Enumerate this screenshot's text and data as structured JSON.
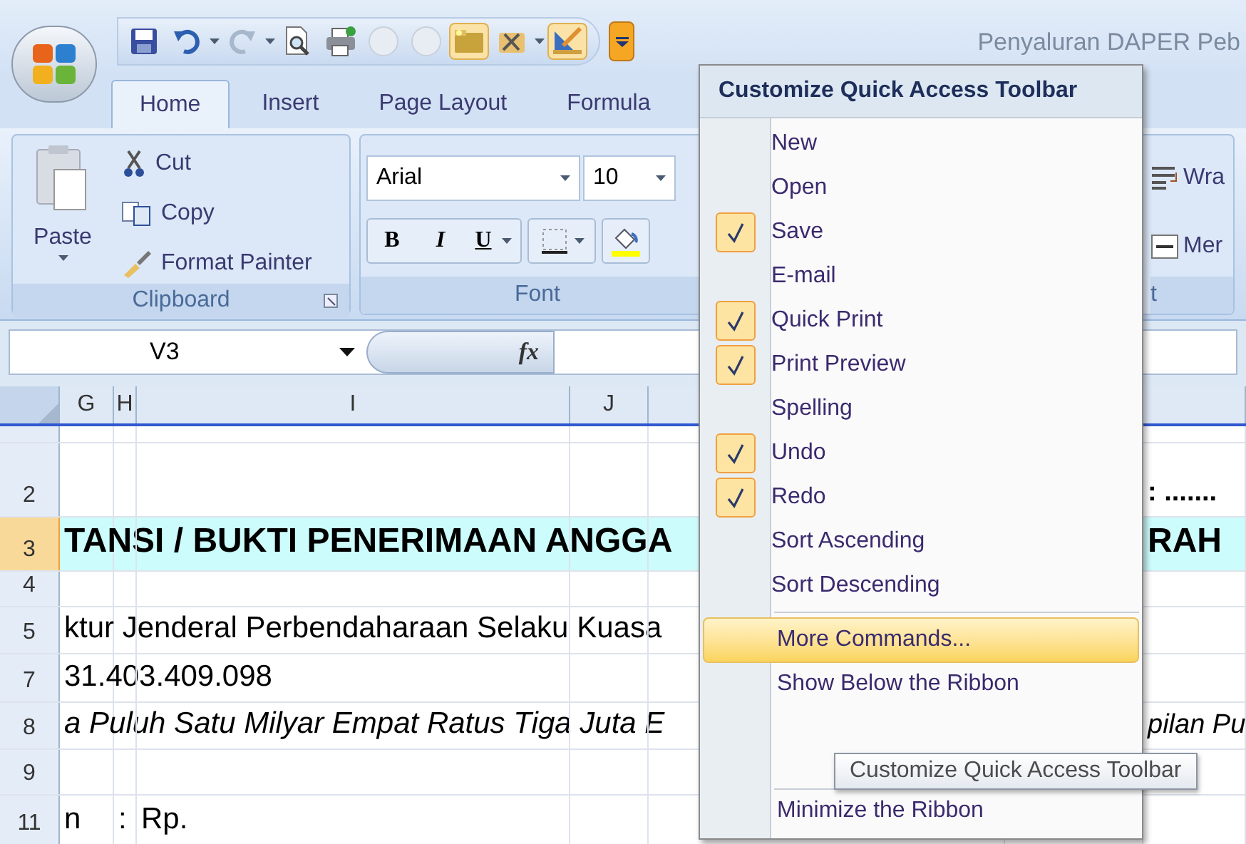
{
  "title_bar": {
    "title": "Penyaluran DAPER Peb"
  },
  "tabs": [
    {
      "label": "Home",
      "selected": true
    },
    {
      "label": "Insert",
      "selected": false
    },
    {
      "label": "Page Layout",
      "selected": false
    },
    {
      "label": "Formula",
      "selected": false
    }
  ],
  "ribbon": {
    "clipboard": {
      "label": "Clipboard",
      "paste": "Paste",
      "cut": "Cut",
      "copy": "Copy",
      "format_painter": "Format Painter"
    },
    "font": {
      "label": "Font",
      "font_name": "Arial",
      "font_size": "10",
      "bold": "B",
      "italic": "I",
      "underline": "U"
    },
    "alignment": {
      "label": "t",
      "wrap": "Wra",
      "merge": "Mer"
    }
  },
  "formula_bar": {
    "name_box": "V3",
    "function_label": "fx"
  },
  "sheet": {
    "columns": [
      "G",
      "H",
      "I",
      "J"
    ],
    "rows": [
      {
        "number": "2",
        "selected": false,
        "highlight": false,
        "kind": "bold",
        "right_text": ": ......."
      },
      {
        "number": "3",
        "selected": true,
        "highlight": true,
        "kind": "title",
        "text": "TANSI / BUKTI PENERIMAAN ANGGA",
        "right_text": "RAH"
      },
      {
        "number": "4",
        "selected": false,
        "highlight": false
      },
      {
        "number": "5",
        "selected": false,
        "highlight": false,
        "kind": "plain",
        "text": "ktur Jenderal Perbendaharaan Selaku Kuasa"
      },
      {
        "number": "7",
        "selected": false,
        "highlight": false,
        "kind": "plain",
        "text": "31.403.409.098"
      },
      {
        "number": "8",
        "selected": false,
        "highlight": false,
        "kind": "italic",
        "text": "a Puluh Satu Milyar Empat Ratus Tiga Juta E",
        "right_text": "pilan Pu"
      },
      {
        "number": "9",
        "selected": false,
        "highlight": false
      },
      {
        "number": "11",
        "selected": false,
        "highlight": false,
        "kind": "plain",
        "cells": [
          "n",
          ":",
          "Rp."
        ]
      }
    ]
  },
  "menu": {
    "title": "Customize Quick Access Toolbar",
    "items": [
      {
        "label": "New",
        "checked": false
      },
      {
        "label": "Open",
        "checked": false
      },
      {
        "label": "Save",
        "checked": true
      },
      {
        "label": "E-mail",
        "checked": false
      },
      {
        "label": "Quick Print",
        "checked": true
      },
      {
        "label": "Print Preview",
        "checked": true
      },
      {
        "label": "Spelling",
        "checked": false
      },
      {
        "label": "Undo",
        "checked": true
      },
      {
        "label": "Redo",
        "checked": true
      },
      {
        "label": "Sort Ascending",
        "checked": false
      },
      {
        "label": "Sort Descending",
        "checked": false
      }
    ],
    "more_commands": {
      "label": "More Commands...",
      "selected": true
    },
    "show_below": {
      "label": "Show Below the Ribbon",
      "selected": false
    },
    "minimize": {
      "label": "Minimize the Ribbon",
      "selected": false
    }
  },
  "tooltip": {
    "text": "Customize Quick Access Toolbar"
  }
}
